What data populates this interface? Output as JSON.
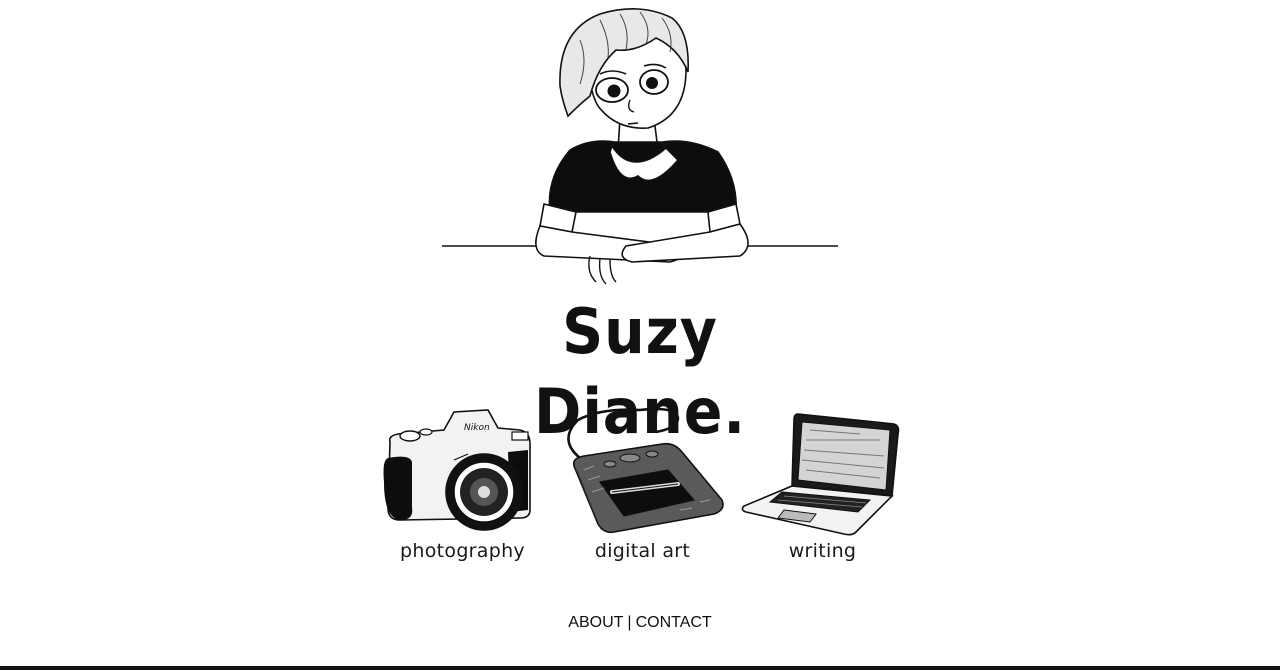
{
  "site": {
    "title": "Suzy Diane."
  },
  "categories": [
    {
      "label": "photography",
      "icon": "camera-icon"
    },
    {
      "label": "digital art",
      "icon": "drawing-tablet-icon"
    },
    {
      "label": "writing",
      "icon": "laptop-icon"
    }
  ],
  "footer": {
    "about": "ABOUT",
    "separator": "|",
    "contact": "CONTACT"
  },
  "colors": {
    "ink": "#111111",
    "background": "#ffffff"
  }
}
